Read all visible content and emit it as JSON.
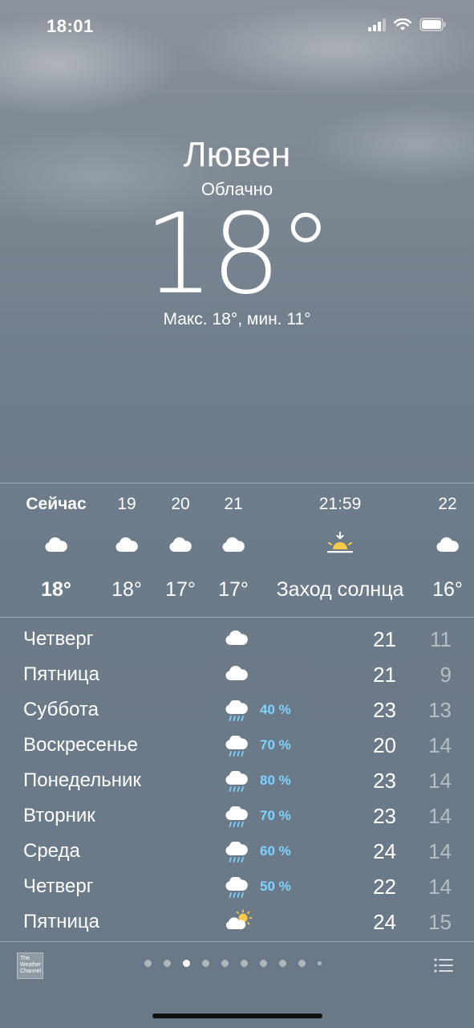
{
  "status": {
    "time": "18:01"
  },
  "header": {
    "city": "Лювен",
    "condition": "Облачно",
    "temperature": "18°",
    "high_low": "Макс. 18°, мин. 11°"
  },
  "hourly": [
    {
      "label": "Сейчас",
      "icon": "cloud-icon",
      "temp": "18°",
      "bold": true
    },
    {
      "label": "19",
      "icon": "cloud-icon",
      "temp": "18°"
    },
    {
      "label": "20",
      "icon": "cloud-icon",
      "temp": "17°"
    },
    {
      "label": "21",
      "icon": "cloud-icon",
      "temp": "17°"
    },
    {
      "label": "21:59",
      "icon": "sunset-icon",
      "temp": "Заход солнца"
    },
    {
      "label": "22",
      "icon": "cloud-icon",
      "temp": "16°"
    }
  ],
  "daily": [
    {
      "day": "Четверг",
      "icon": "cloud-icon",
      "precip": "",
      "max": "21",
      "min": "11"
    },
    {
      "day": "Пятница",
      "icon": "cloud-icon",
      "precip": "",
      "max": "21",
      "min": "9"
    },
    {
      "day": "Суббота",
      "icon": "rain-cloud-icon",
      "precip": "40 %",
      "max": "23",
      "min": "13"
    },
    {
      "day": "Воскресенье",
      "icon": "rain-cloud-icon",
      "precip": "70 %",
      "max": "20",
      "min": "14"
    },
    {
      "day": "Понедельник",
      "icon": "rain-cloud-icon",
      "precip": "80 %",
      "max": "23",
      "min": "14"
    },
    {
      "day": "Вторник",
      "icon": "rain-cloud-icon",
      "precip": "70 %",
      "max": "23",
      "min": "14"
    },
    {
      "day": "Среда",
      "icon": "rain-cloud-icon",
      "precip": "60 %",
      "max": "24",
      "min": "14"
    },
    {
      "day": "Четверг",
      "icon": "rain-cloud-icon",
      "precip": "50 %",
      "max": "22",
      "min": "14"
    },
    {
      "day": "Пятница",
      "icon": "sun-cloud-icon",
      "precip": "",
      "max": "24",
      "min": "15"
    }
  ],
  "footer": {
    "provider": "The Weather Channel",
    "page_count": 10,
    "active_page": 3
  },
  "colors": {
    "precip": "#7fd3ff",
    "sun": "#f7c948"
  }
}
